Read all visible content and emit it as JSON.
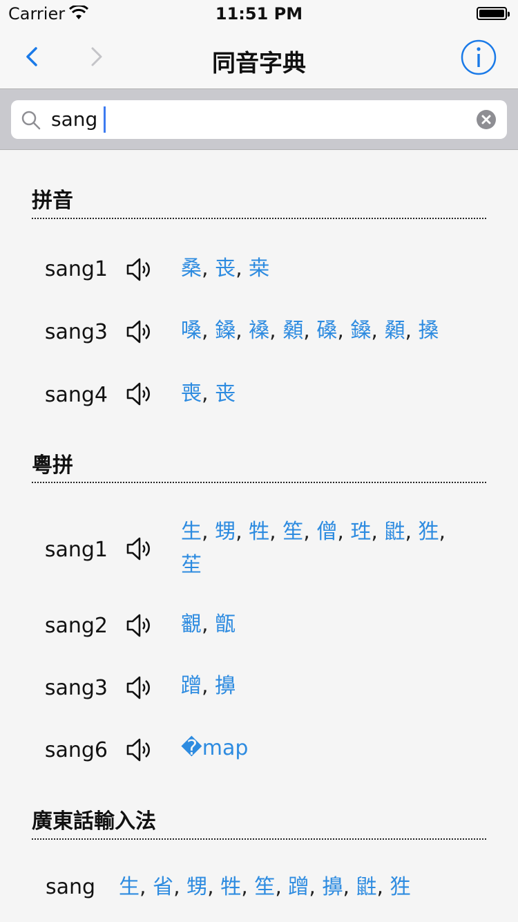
{
  "status_bar": {
    "carrier": "Carrier",
    "time": "11:51 PM"
  },
  "nav": {
    "title": "同音字典"
  },
  "search": {
    "value": "sang",
    "placeholder": ""
  },
  "sections": {
    "pinyin": {
      "title": "拼音",
      "rows": [
        {
          "label": "sang1",
          "chars": [
            "桑",
            "丧",
            "桒"
          ]
        },
        {
          "label": "sang3",
          "chars": [
            "嗓",
            "鎟",
            "褬",
            "顙",
            "磉",
            "鎟",
            "顙",
            "搡"
          ]
        },
        {
          "label": "sang4",
          "chars": [
            "喪",
            "丧"
          ]
        }
      ]
    },
    "jyutping": {
      "title": "粵拼",
      "rows": [
        {
          "label": "sang1",
          "chars": [
            "生",
            "甥",
            "牲",
            "笙",
            "僧",
            "珄",
            "鼪",
            "狌",
            "苼"
          ]
        },
        {
          "label": "sang2",
          "chars": [
            "覾",
            "甑"
          ]
        },
        {
          "label": "sang3",
          "chars": [
            "蹭",
            "擤"
          ]
        },
        {
          "label": "sang6",
          "chars": [
            "�map"
          ]
        }
      ]
    },
    "ime": {
      "title": "廣東話輸入法",
      "label": "sang",
      "chars": [
        "生",
        "省",
        "甥",
        "牲",
        "笙",
        "蹭",
        "擤",
        "鼪",
        "狌"
      ]
    }
  }
}
